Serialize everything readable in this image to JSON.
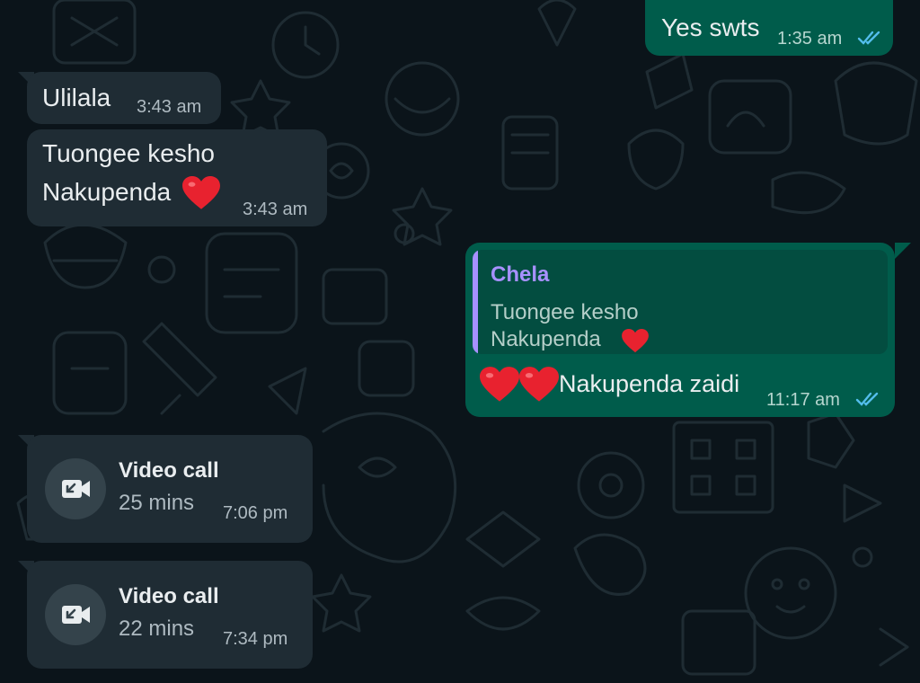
{
  "messages": [
    {
      "text": "Yes swts",
      "time": "1:35 am",
      "status": "read"
    },
    {
      "text": "Ulilala",
      "time": "3:43 am"
    },
    {
      "line1": "Tuongee kesho",
      "line2": "Nakupenda",
      "emoji": "heart",
      "time": "3:43 am"
    },
    {
      "quote": {
        "author": "Chela",
        "line1": "Tuongee kesho",
        "line2": "Nakupenda",
        "emoji": "heart"
      },
      "text": "Nakupenda zaidi",
      "emoji_prefix": "two hearts",
      "time": "11:17 am",
      "status": "read"
    }
  ],
  "calls": [
    {
      "title": "Video call",
      "duration": "25 mins",
      "time": "7:06 pm",
      "icon": "video-call-icon"
    },
    {
      "title": "Video call",
      "duration": "22 mins",
      "time": "7:34 pm",
      "icon": "video-call-icon"
    }
  ],
  "colors": {
    "background": "#0b141a",
    "incoming_bubble": "#1f2c34",
    "outgoing_bubble": "#005c4b",
    "quote_author": "#a791ff",
    "read_ticks": "#53bdeb",
    "heart": "#e8222f"
  }
}
